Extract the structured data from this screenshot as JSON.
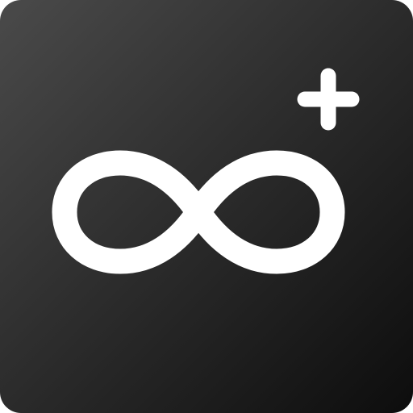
{
  "app_icon": {
    "name": "infinity-plus",
    "icons": [
      "infinity-icon",
      "plus-icon"
    ],
    "colors": {
      "background_start": "#4a4a4a",
      "background_mid": "#2e2e2e",
      "background_end": "#0d0d0d",
      "glyph": "#ffffff"
    }
  }
}
